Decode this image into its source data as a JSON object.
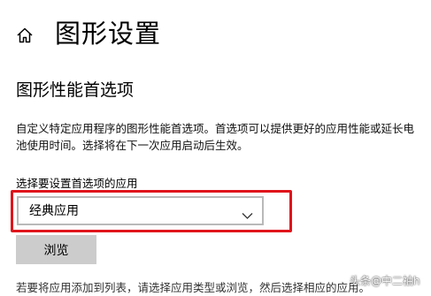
{
  "header": {
    "title": "图形设置",
    "home_icon": "home-icon"
  },
  "section": {
    "title": "图形性能首选项",
    "description": "自定义特定应用程序的图形性能首选项。首选项可以提供更好的应用性能或延长电池使用时间。选择将在下一次应用启动后生效。"
  },
  "app_selector": {
    "label": "选择要设置首选项的应用",
    "selected_value": "经典应用",
    "chevron_icon": "chevron-down-icon",
    "highlight_color": "#e0141b"
  },
  "browse": {
    "label": "浏览"
  },
  "partial_text": "若要将应用添加到列表，请选择应用类型或浏览，然后选择相应的应用。",
  "watermark": "头条@中二袖h"
}
